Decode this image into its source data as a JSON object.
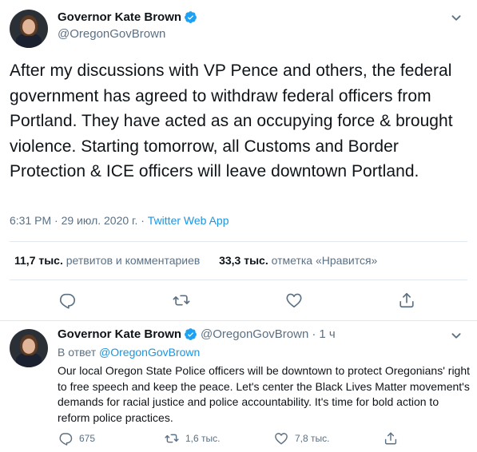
{
  "main_tweet": {
    "author_name": "Governor Kate Brown",
    "author_handle": "@OregonGovBrown",
    "text": "After my discussions with VP Pence and others, the federal government has agreed to withdraw federal officers from Portland. They have acted as an occupying force & brought violence. Starting tomorrow, all Customs and Border Protection & ICE officers will leave downtown Portland.",
    "time": "6:31 PM",
    "date": "29 июл. 2020 г.",
    "separator": "·",
    "app": "Twitter Web App",
    "retweets_count": "11,7 тыс.",
    "retweets_label": "ретвитов и комментариев",
    "likes_count": "33,3 тыс.",
    "likes_label": "отметка «Нравится»"
  },
  "reply_tweet": {
    "author_name": "Governor Kate Brown",
    "author_handle": "@OregonGovBrown",
    "dot": "·",
    "age": "1 ч",
    "reply_prefix": "В ответ",
    "reply_to": "@OregonGovBrown",
    "text": "Our local Oregon State Police officers will be downtown to protect Oregonians' right to free speech and keep the peace. Let's center the Black Lives Matter movement's demands for racial justice and police accountability. It's time for bold action to reform police practices.",
    "replies": "675",
    "retweets": "1,6 тыс.",
    "likes": "7,8 тыс."
  },
  "colors": {
    "accent": "#1b95e0",
    "verified": "#1da1f2",
    "secondary_text": "#5b7083",
    "divider": "#e1e8ed"
  },
  "icons": [
    "verified-badge-icon",
    "chevron-down-icon",
    "reply-icon",
    "retweet-icon",
    "like-icon",
    "share-icon"
  ]
}
